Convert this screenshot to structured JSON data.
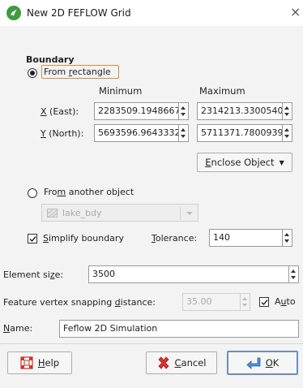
{
  "window": {
    "title": "New 2D FEFLOW Grid",
    "close_glyph": "×"
  },
  "boundary": {
    "group_label": "Boundary",
    "from_rectangle": {
      "label_pre": "From ",
      "label_u": "r",
      "label_post": "ectangle",
      "selected": true
    },
    "col_min": "Minimum",
    "col_max": "Maximum",
    "x_label_u": "X",
    "x_label_post": " (East):",
    "y_label_u": "Y",
    "y_label_post": " (North):",
    "x_min": "2283509.1948667",
    "x_max": "2314213.3300540",
    "y_min": "5693596.9643332",
    "y_max": "5711371.7800939",
    "enclose_pre": "",
    "enclose_u": "E",
    "enclose_post": "nclose Object",
    "enclose_arrow": "▼",
    "from_object": {
      "label_pre": "Fro",
      "label_u": "m",
      "label_post": " another object",
      "selected": false
    },
    "object_value": "lake_bdy",
    "simplify": {
      "label_u": "S",
      "label_post": "implify boundary",
      "checked": true
    },
    "tolerance_label_u": "T",
    "tolerance_label_post": "olerance:",
    "tolerance_value": "140"
  },
  "element_size": {
    "label_pre": "Element si",
    "label_u": "z",
    "label_post": "e:",
    "value": "3500"
  },
  "snapping": {
    "label_pre": "Feature vertex snapping ",
    "label_u": "d",
    "label_post": "istance:",
    "value": "35.00",
    "auto_label_pre": "A",
    "auto_label_u": "u",
    "auto_label_post": "to",
    "auto_checked": true
  },
  "name": {
    "label_u": "N",
    "label_post": "ame:",
    "value": "Feflow 2D Simulation"
  },
  "buttons": {
    "help_u": "H",
    "help_post": "elp",
    "cancel_u": "C",
    "cancel_post": "ancel",
    "ok_u": "O",
    "ok_post": "K"
  }
}
